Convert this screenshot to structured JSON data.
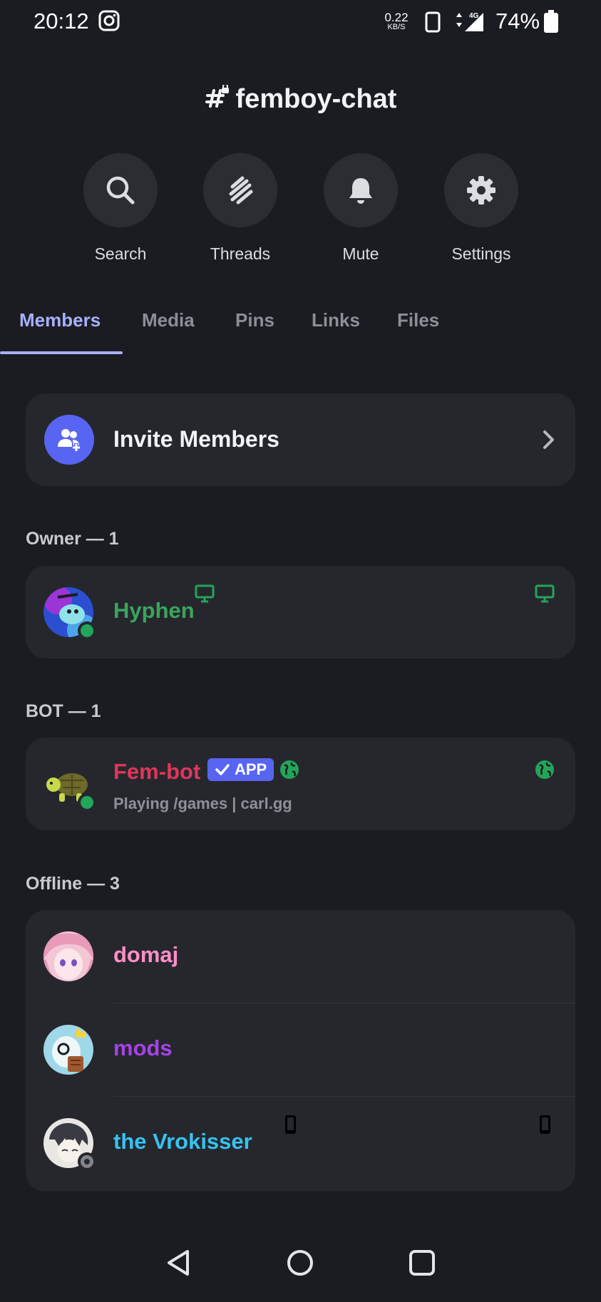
{
  "status_bar": {
    "time": "20:12",
    "speed_value": "0.22",
    "speed_unit": "KB/S",
    "network": "4G",
    "battery": "74%"
  },
  "channel": {
    "name": "femboy-chat"
  },
  "actions": [
    {
      "label": "Search",
      "icon": "search-icon"
    },
    {
      "label": "Threads",
      "icon": "threads-icon"
    },
    {
      "label": "Mute",
      "icon": "bell-icon"
    },
    {
      "label": "Settings",
      "icon": "gear-icon"
    }
  ],
  "tabs": [
    "Members",
    "Media",
    "Pins",
    "Links",
    "Files"
  ],
  "active_tab": "Members",
  "invite": {
    "label": "Invite Members"
  },
  "sections": {
    "owner": {
      "label": "Owner — 1"
    },
    "bot": {
      "label": "BOT — 1"
    },
    "offline": {
      "label": "Offline — 3"
    }
  },
  "members": {
    "owner": [
      {
        "name": "Hyphen",
        "color": "#3ba55c",
        "status": "online",
        "platform": "desktop"
      }
    ],
    "bot": [
      {
        "name": "Fem-bot",
        "color": "#e0365a",
        "badge": "APP",
        "activity": "Playing /games | carl.gg",
        "status": "online",
        "platform": "web"
      }
    ],
    "offline": [
      {
        "name": "domaj",
        "color": "#ff8fc7"
      },
      {
        "name": "mods",
        "color": "#a642e8"
      },
      {
        "name": "the Vrokisser",
        "color": "#36c3f0",
        "status": "offline",
        "platform": "mobile"
      }
    ]
  },
  "colors": {
    "background": "#1b1c21",
    "card": "#26272d",
    "accent": "#5865f2",
    "tab_active": "#a7b0ff",
    "online": "#23a55a"
  }
}
